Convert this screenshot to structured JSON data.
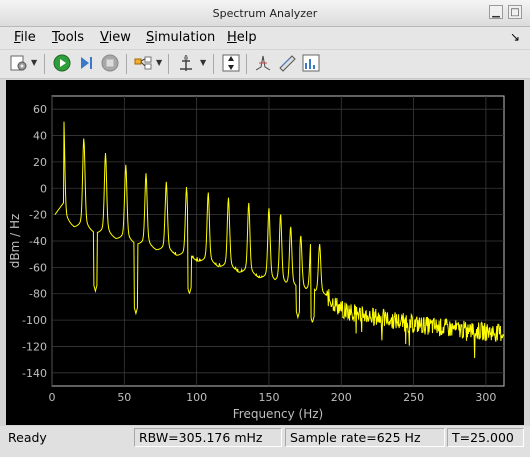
{
  "window": {
    "title": "Spectrum Analyzer"
  },
  "menu": {
    "items": [
      {
        "label": "File",
        "key": "F",
        "rest": "ile"
      },
      {
        "label": "Tools",
        "key": "T",
        "rest": "ools"
      },
      {
        "label": "View",
        "key": "V",
        "rest": "iew"
      },
      {
        "label": "Simulation",
        "key": "S",
        "rest": "imulation"
      },
      {
        "label": "Help",
        "key": "H",
        "rest": "elp"
      }
    ],
    "dock_symbol": "↘"
  },
  "toolbar": {
    "icons": [
      "settings-icon",
      "run-icon",
      "step-forward-icon",
      "stop-icon",
      "signal-select-icon",
      "cursor-measure-icon",
      "autoscale-icon",
      "peak-finder-icon",
      "channel-measure-icon",
      "distortion-measure-icon"
    ]
  },
  "chart_data": {
    "type": "line",
    "xlabel": "Frequency (Hz)",
    "ylabel": "dBm / Hz",
    "xlim": [
      0,
      312.5
    ],
    "ylim": [
      -150,
      70
    ],
    "xticks": [
      0,
      50,
      100,
      150,
      200,
      250,
      300
    ],
    "yticks": [
      60,
      40,
      20,
      0,
      -20,
      -40,
      -60,
      -80,
      -100,
      -120,
      -140
    ],
    "grid": true,
    "colors": {
      "background": "#000000",
      "trace": "#ffff00",
      "grid": "#3a3a3a",
      "axis": "#bfbfbf"
    },
    "peaks": [
      {
        "x": 8,
        "y": 40
      },
      {
        "x": 22,
        "y": 24
      },
      {
        "x": 37,
        "y": 14
      },
      {
        "x": 51,
        "y": 6
      },
      {
        "x": 65,
        "y": 0
      },
      {
        "x": 79,
        "y": -6
      },
      {
        "x": 93,
        "y": -10
      },
      {
        "x": 108,
        "y": -14
      },
      {
        "x": 122,
        "y": -18
      },
      {
        "x": 136,
        "y": -22
      },
      {
        "x": 150,
        "y": -26
      },
      {
        "x": 158,
        "y": -30
      },
      {
        "x": 165,
        "y": -38
      },
      {
        "x": 172,
        "y": -44
      },
      {
        "x": 179,
        "y": -48
      },
      {
        "x": 185,
        "y": -50
      }
    ],
    "notches": [
      {
        "x": 30,
        "y": -78
      },
      {
        "x": 58,
        "y": -95
      },
      {
        "x": 95,
        "y": -80
      },
      {
        "x": 170,
        "y": -98
      },
      {
        "x": 180,
        "y": -102
      }
    ],
    "noise_floor": [
      {
        "x": 190,
        "y": -82
      },
      {
        "x": 200,
        "y": -92
      },
      {
        "x": 220,
        "y": -97
      },
      {
        "x": 250,
        "y": -103
      },
      {
        "x": 280,
        "y": -107
      },
      {
        "x": 312.5,
        "y": -110
      }
    ]
  },
  "status": {
    "state": "Ready",
    "rbw": "RBW=305.176 mHz",
    "sample_rate": "Sample rate=625 Hz",
    "time": "T=25.000"
  }
}
